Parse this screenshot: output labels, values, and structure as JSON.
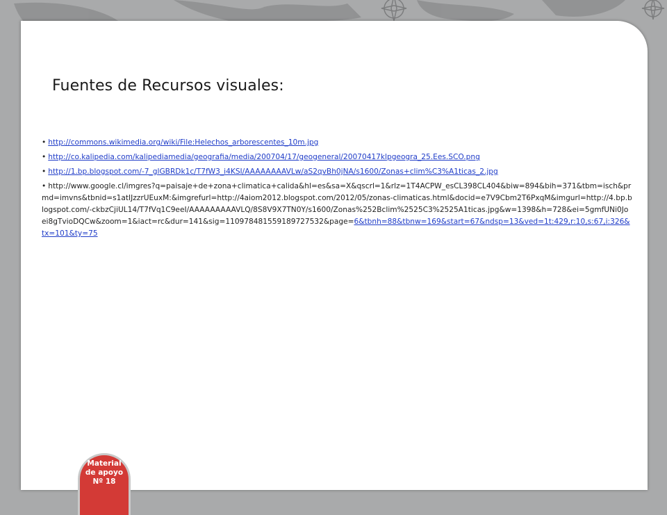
{
  "slide": {
    "title": "Fuentes de Recursos visuales:",
    "bullet": "•",
    "links": [
      {
        "text": "http://commons.wikimedia.org/wiki/File:Helechos_arborescentes_10m.jpg"
      },
      {
        "text": "http://co.kalipedia.com/kalipediamedia/geografia/media/200704/17/geogeneral/20070417klpgeogra_25.Ees.SCO.png"
      },
      {
        "text": "http://1.bp.blogspot.com/-7_glGBRDk1c/T7fW3_i4KSI/AAAAAAAAVLw/aS2qvBh0jNA/s1600/Zonas+clim%C3%A1ticas_2.jpg"
      }
    ],
    "long_link": {
      "plain": "http://www.google.cl/imgres?q=paisaje+de+zona+climatica+calida&hl=es&sa=X&qscrl=1&rlz=1T4ACPW_esCL398CL404&biw=894&bih=371&tbm=isch&prmd=imvns&tbnid=s1atIJzzrUEuxM:&imgrefurl=http://4aiom2012.blogspot.com/2012/05/zonas-climaticas.html&docid=e7V9Cbm2T6PxqM&imgurl=http://4.bp.blogspot.com/-ckbzCjiUL14/T7fVq1C9eeI/AAAAAAAAAVLQ/8S8V9X7TN0Y/s1600/Zonas%252Bclim%2525C3%2525A1ticas.jpg&w=1398&h=728&ei=5gmfUNi0Joei8gTvioDQCw&zoom=1&iact=rc&dur=141&sig=110978481559189727532&page=",
      "linked": "6&tbnh=88&tbnw=169&start=67&ndsp=13&ved=1t:429,r:10,s:67,i:326&tx=101&ty=75"
    },
    "badge": {
      "line1": "Material",
      "line2": "de apoyo",
      "line3": "Nº 18"
    }
  },
  "colors": {
    "link": "#1f3cc8",
    "badge": "#d33a36",
    "background": "#a9aaab"
  }
}
